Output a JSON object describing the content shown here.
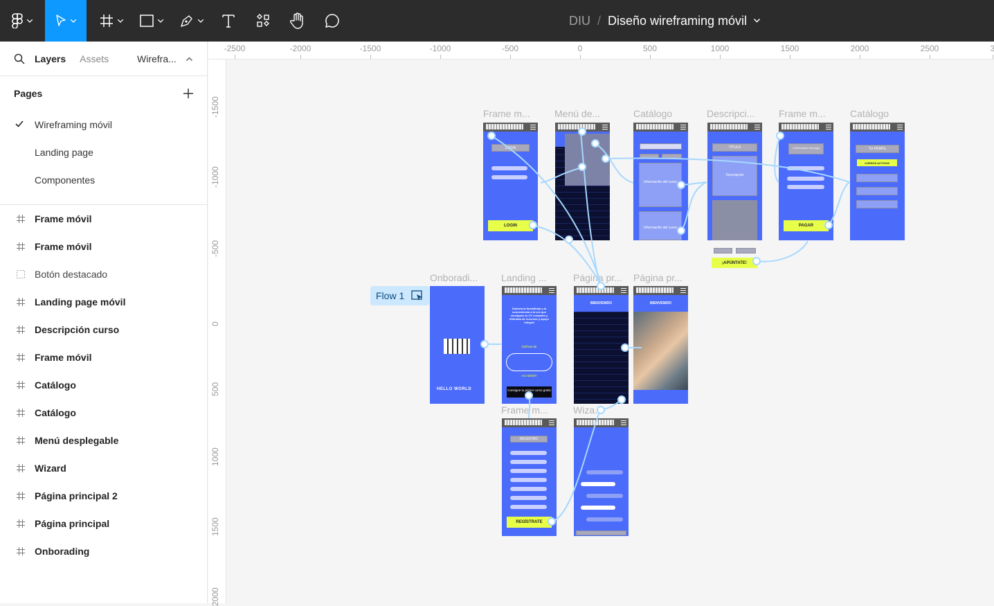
{
  "toolbar": {
    "project": "DIU",
    "separator": "/",
    "file_name": "Diseño wireframing móvil"
  },
  "sidebar": {
    "tabs": {
      "layers": "Layers",
      "assets": "Assets",
      "page_selector": "Wirefra..."
    },
    "pages_title": "Pages",
    "pages": [
      {
        "label": "Wireframing móvil",
        "selected": true
      },
      {
        "label": "Landing page",
        "selected": false
      },
      {
        "label": "Componentes",
        "selected": false
      }
    ],
    "layers": [
      {
        "label": "Frame móvil",
        "icon": "frame-icon"
      },
      {
        "label": "Frame móvil",
        "icon": "frame-icon"
      },
      {
        "label": "Botón destacado",
        "icon": "component-icon"
      },
      {
        "label": "Landing page móvil",
        "icon": "frame-icon"
      },
      {
        "label": "Descripción curso",
        "icon": "frame-icon"
      },
      {
        "label": "Frame móvil",
        "icon": "frame-icon"
      },
      {
        "label": "Catálogo",
        "icon": "frame-icon"
      },
      {
        "label": "Catálogo",
        "icon": "frame-icon"
      },
      {
        "label": "Menú desplegable",
        "icon": "frame-icon"
      },
      {
        "label": "Wizard",
        "icon": "frame-icon"
      },
      {
        "label": "Página principal 2",
        "icon": "frame-icon"
      },
      {
        "label": "Página principal",
        "icon": "frame-icon"
      },
      {
        "label": "Onborading",
        "icon": "frame-icon"
      }
    ]
  },
  "ruler": {
    "top": [
      "-2500",
      "-2000",
      "-1500",
      "-1000",
      "-500",
      "0",
      "500",
      "1000",
      "1500",
      "2000",
      "2500",
      "3"
    ],
    "left": [
      "-1500",
      "-1000",
      "-500",
      "0",
      "500",
      "1000",
      "1500",
      "2000"
    ]
  },
  "canvas": {
    "flow_chip": "Flow 1",
    "frame_labels": {
      "frame_movil_1": "Frame m...",
      "menu": "Menú de...",
      "catalogo_1": "Catálogo",
      "descripcion": "Descripci...",
      "frame_movil_2": "Frame m...",
      "catalogo_2": "Catálogo",
      "onboarding": "Onboradi...",
      "landing": "Landing ...",
      "principal": "Página pr...",
      "principal_2": "Página pr...",
      "frame_movil_3": "Frame m...",
      "wizard": "Wiza..."
    },
    "frame_texts": {
      "login_title": "LOGIN",
      "login_button": "LOGIN",
      "pagar_button": "PAGAR",
      "apuntate_button": "¡APÚNTATE!",
      "registrate_button": "REGÍSTRATE",
      "registro_title": "REGISTRO",
      "bienvenido": "BIENVENIDO",
      "bienvenido_2": "BIENVENIDO",
      "cursos_activos": "CURSOS ACTIVOS",
      "tu_perfil": "TU PERFIL",
      "titulo": "TÍTULO",
      "descripcion": "Descripción",
      "confirmacion": "Confirmación de pago",
      "info_curso": "Información del curso",
      "info_curso_2": "Información del curso",
      "landing_copy": "Disfruta la flexibilidad y la conveniencia a la vez que consigues tu CV completo y disfrutas de recursos y apoyo integral",
      "disfruta_de": "Disfruta de",
      "academy": "ACADEMY",
      "consigue": "Consigue tu primer curso gratis",
      "hello_world": "HELLO WORLD"
    }
  },
  "colors": {
    "toolbar_bg": "#2c2c2c",
    "accent": "#0d99ff",
    "frame_blue": "#4b6bfb",
    "highlight_yellow": "#e8ff4a",
    "connector": "#a7d8ff"
  }
}
